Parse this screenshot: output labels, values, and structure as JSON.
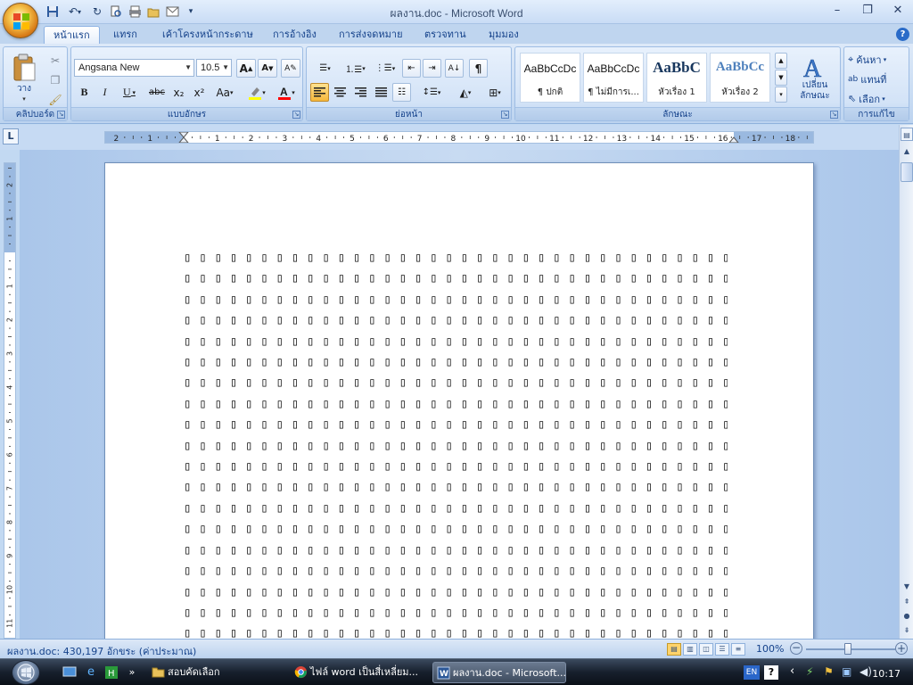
{
  "window": {
    "title": "ผลงาน.doc - Microsoft Word",
    "controls": {
      "minimize": "–",
      "restore": "❐",
      "close": "✕"
    }
  },
  "qat": {
    "icons": [
      "save-icon",
      "undo-icon",
      "redo-icon",
      "print-preview-icon",
      "quick-print-icon",
      "open-icon",
      "email-icon",
      "customize-icon"
    ]
  },
  "tabs": [
    {
      "label": "หน้าแรก",
      "active": true
    },
    {
      "label": "แทรก"
    },
    {
      "label": "เค้าโครงหน้ากระดาษ"
    },
    {
      "label": "การอ้างอิง"
    },
    {
      "label": "การส่งจดหมาย"
    },
    {
      "label": "ตรวจทาน"
    },
    {
      "label": "มุมมอง"
    }
  ],
  "help": "?",
  "ribbon": {
    "clipboard": {
      "label": "คลิปบอร์ด",
      "paste_label": "วาง"
    },
    "font": {
      "label": "แบบอักษร",
      "font_name": "Angsana New",
      "font_size": "10.5",
      "bold": "B",
      "italic": "I",
      "underline": "U",
      "strike": "abc",
      "subscript": "x₂",
      "superscript": "x²",
      "change_case": "Aa",
      "grow": "A",
      "shrink": "A",
      "highlight_color": "#ffff00",
      "font_color": "#ff0000"
    },
    "paragraph": {
      "label": "ย่อหน้า",
      "pilcrow": "¶"
    },
    "styles": {
      "label": "ลักษณะ",
      "items": [
        {
          "sample": "AaBbCcDc",
          "name": "¶ ปกติ"
        },
        {
          "sample": "AaBbCcDc",
          "name": "¶ ไม่มีการเ..."
        },
        {
          "sample": "AaBbC",
          "name": "หัวเรื่อง 1"
        },
        {
          "sample": "AaBbCc",
          "name": "หัวเรื่อง 2"
        }
      ],
      "change_styles_line1": "เปลี่ยน",
      "change_styles_line2": "ลักษณะ"
    },
    "editing": {
      "label": "การแก้ไข",
      "find": "ค้นหา",
      "replace": "แทนที่",
      "select": "เลือก"
    }
  },
  "ruler": {
    "corner": "L",
    "h_labels": [
      "2",
      "1",
      "1",
      "2",
      "3",
      "4",
      "5",
      "6",
      "7",
      "8",
      "9",
      "10",
      "11",
      "12",
      "13",
      "14",
      "15",
      "16",
      "17",
      "18"
    ],
    "v_labels": [
      "2",
      "1",
      "1",
      "2",
      "3",
      "4",
      "5",
      "6",
      "7",
      "8",
      "9",
      "10",
      "11"
    ]
  },
  "document": {
    "glyph": "▯",
    "columns": 47,
    "rows": 19
  },
  "statusbar": {
    "text": "ผลงาน.doc: 430,197 อักขระ (ค่าประมาณ)",
    "zoom": "100%",
    "zoom_out": "−",
    "zoom_in": "+"
  },
  "taskbar": {
    "tasks": [
      {
        "label": "สอบคัดเลือก",
        "icon": "folder-icon"
      },
      {
        "label": "ไฟล์ word เป็นสี่เหลี่ยม...",
        "icon": "chrome-icon"
      },
      {
        "label": "ผลงาน.doc - Microsoft...",
        "icon": "word-icon",
        "active": true
      }
    ],
    "lang": "EN",
    "clock": "10:17"
  }
}
